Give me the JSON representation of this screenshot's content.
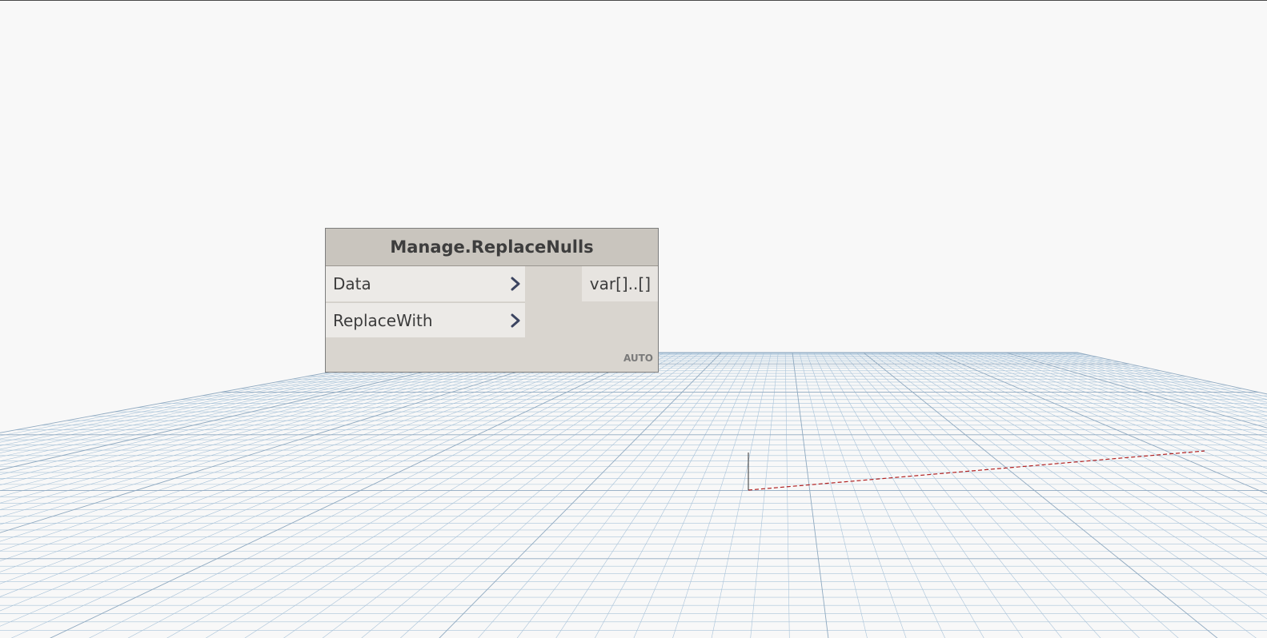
{
  "node": {
    "title": "Manage.ReplaceNulls",
    "inputs": [
      {
        "label": "Data"
      },
      {
        "label": "ReplaceWith"
      }
    ],
    "output": {
      "label": "var[]..[]"
    },
    "lacing": "AUTO"
  },
  "colors": {
    "background": "#f8f8f8",
    "grid": "#a9c3d9",
    "node_header": "#c9c5be",
    "node_body": "#d9d5cf",
    "axis_x": "#c0392b"
  }
}
